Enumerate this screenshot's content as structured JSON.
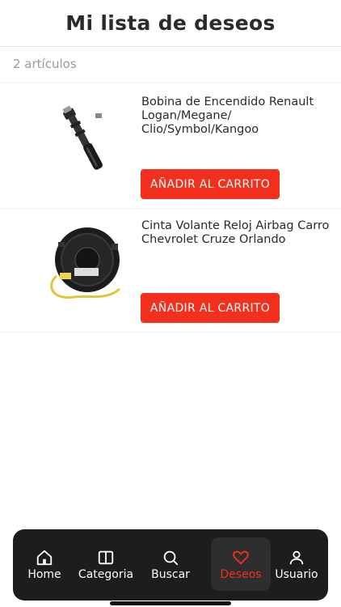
{
  "header": {
    "title": "Mi lista de deseos"
  },
  "count": {
    "label": "2 artículos"
  },
  "items": [
    {
      "title": "Bobina de Encendido Renault Logan/Megane/ Clio/Symbol/Kangoo",
      "button": "AÑADIR AL CARRITO",
      "image": "ignition-coil"
    },
    {
      "title": "Cinta Volante Reloj Airbag Carro Chevrolet Cruze Orlando",
      "button": "AÑADIR AL CARRITO",
      "image": "clock-spring"
    }
  ],
  "tabs": [
    {
      "label": "Home",
      "icon": "home-icon"
    },
    {
      "label": "Categoria",
      "icon": "categories-icon"
    },
    {
      "label": "Buscar",
      "icon": "search-icon"
    },
    {
      "label": "Deseos",
      "icon": "heart-icon",
      "active": true
    },
    {
      "label": "Usuario",
      "icon": "user-icon"
    }
  ],
  "colors": {
    "accent": "#f2301d",
    "tabbar": "#1d1d1d",
    "muted": "#9a9a9a"
  }
}
